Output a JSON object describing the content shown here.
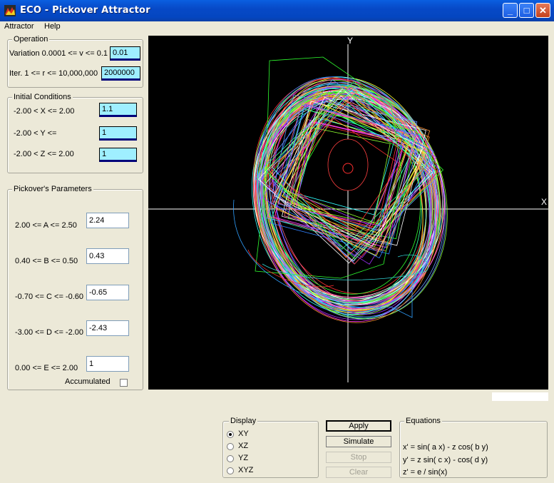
{
  "window": {
    "title": "ECO - Pickover Attractor",
    "min_symbol": "_",
    "max_symbol": "□",
    "close_symbol": "✕"
  },
  "menu": [
    "Attractor",
    "Help"
  ],
  "operation": {
    "legend": "Operation",
    "variation_label": "Variation  0.0001 <= v <= 0.1",
    "variation_value": "0.01",
    "iter_label": "Iter. 1 <= r <= 10,000,000",
    "iter_value": "2000000"
  },
  "initial_conditions": {
    "legend": "Initial Conditions",
    "x_label": "-2.00 < X <= 2.00",
    "x_value": "1.1",
    "y_label": "-2.00 < Y <=",
    "y_value": "1",
    "z_label": "-2.00 < Z <= 2.00",
    "z_value": "1"
  },
  "parameters": {
    "legend": "Pickover's Parameters",
    "items": [
      {
        "label": "2.00 <= A <= 2.50",
        "value": "2.24"
      },
      {
        "label": "0.40 <= B <= 0.50",
        "value": "0.43"
      },
      {
        "label": "-0.70 <= C <= -0.60",
        "value": "-0.65"
      },
      {
        "label": "-3.00 <= D <= -2.00",
        "value": "-2.43"
      },
      {
        "label": "0.00 <= E <= 2.00",
        "value": "1"
      }
    ],
    "accumulated_label": "Accumulated",
    "accumulated_checked": false
  },
  "plot": {
    "y_axis_label": "Y",
    "x_axis_label": "X"
  },
  "display": {
    "legend": "Display",
    "options": [
      "XY",
      "XZ",
      "YZ",
      "XYZ"
    ],
    "selected": "XY"
  },
  "buttons": {
    "apply": "Apply",
    "simulate": "Simulate",
    "stop": "Stop",
    "clear": "Clear"
  },
  "equations": {
    "legend": "Equations",
    "lines": [
      "x' = sin( a x) - z cos( b y)",
      "y' = z sin( c x) - cos( d y)",
      "z' = e / sin(x)"
    ]
  }
}
